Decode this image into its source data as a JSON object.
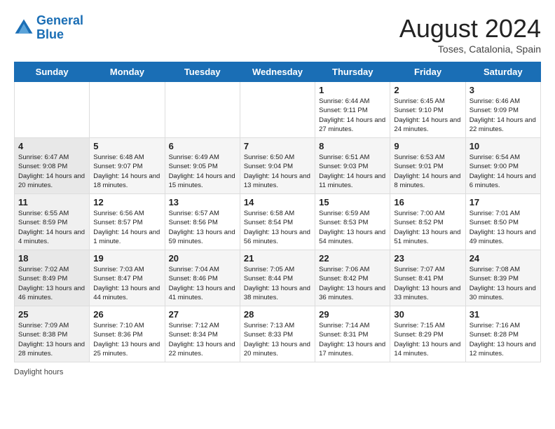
{
  "logo": {
    "line1": "General",
    "line2": "Blue"
  },
  "title": "August 2024",
  "location": "Toses, Catalonia, Spain",
  "days_of_week": [
    "Sunday",
    "Monday",
    "Tuesday",
    "Wednesday",
    "Thursday",
    "Friday",
    "Saturday"
  ],
  "footer_label": "Daylight hours",
  "weeks": [
    [
      {
        "num": "",
        "info": ""
      },
      {
        "num": "",
        "info": ""
      },
      {
        "num": "",
        "info": ""
      },
      {
        "num": "",
        "info": ""
      },
      {
        "num": "1",
        "info": "Sunrise: 6:44 AM\nSunset: 9:11 PM\nDaylight: 14 hours and 27 minutes."
      },
      {
        "num": "2",
        "info": "Sunrise: 6:45 AM\nSunset: 9:10 PM\nDaylight: 14 hours and 24 minutes."
      },
      {
        "num": "3",
        "info": "Sunrise: 6:46 AM\nSunset: 9:09 PM\nDaylight: 14 hours and 22 minutes."
      }
    ],
    [
      {
        "num": "4",
        "info": "Sunrise: 6:47 AM\nSunset: 9:08 PM\nDaylight: 14 hours and 20 minutes."
      },
      {
        "num": "5",
        "info": "Sunrise: 6:48 AM\nSunset: 9:07 PM\nDaylight: 14 hours and 18 minutes."
      },
      {
        "num": "6",
        "info": "Sunrise: 6:49 AM\nSunset: 9:05 PM\nDaylight: 14 hours and 15 minutes."
      },
      {
        "num": "7",
        "info": "Sunrise: 6:50 AM\nSunset: 9:04 PM\nDaylight: 14 hours and 13 minutes."
      },
      {
        "num": "8",
        "info": "Sunrise: 6:51 AM\nSunset: 9:03 PM\nDaylight: 14 hours and 11 minutes."
      },
      {
        "num": "9",
        "info": "Sunrise: 6:53 AM\nSunset: 9:01 PM\nDaylight: 14 hours and 8 minutes."
      },
      {
        "num": "10",
        "info": "Sunrise: 6:54 AM\nSunset: 9:00 PM\nDaylight: 14 hours and 6 minutes."
      }
    ],
    [
      {
        "num": "11",
        "info": "Sunrise: 6:55 AM\nSunset: 8:59 PM\nDaylight: 14 hours and 4 minutes."
      },
      {
        "num": "12",
        "info": "Sunrise: 6:56 AM\nSunset: 8:57 PM\nDaylight: 14 hours and 1 minute."
      },
      {
        "num": "13",
        "info": "Sunrise: 6:57 AM\nSunset: 8:56 PM\nDaylight: 13 hours and 59 minutes."
      },
      {
        "num": "14",
        "info": "Sunrise: 6:58 AM\nSunset: 8:54 PM\nDaylight: 13 hours and 56 minutes."
      },
      {
        "num": "15",
        "info": "Sunrise: 6:59 AM\nSunset: 8:53 PM\nDaylight: 13 hours and 54 minutes."
      },
      {
        "num": "16",
        "info": "Sunrise: 7:00 AM\nSunset: 8:52 PM\nDaylight: 13 hours and 51 minutes."
      },
      {
        "num": "17",
        "info": "Sunrise: 7:01 AM\nSunset: 8:50 PM\nDaylight: 13 hours and 49 minutes."
      }
    ],
    [
      {
        "num": "18",
        "info": "Sunrise: 7:02 AM\nSunset: 8:49 PM\nDaylight: 13 hours and 46 minutes."
      },
      {
        "num": "19",
        "info": "Sunrise: 7:03 AM\nSunset: 8:47 PM\nDaylight: 13 hours and 44 minutes."
      },
      {
        "num": "20",
        "info": "Sunrise: 7:04 AM\nSunset: 8:46 PM\nDaylight: 13 hours and 41 minutes."
      },
      {
        "num": "21",
        "info": "Sunrise: 7:05 AM\nSunset: 8:44 PM\nDaylight: 13 hours and 38 minutes."
      },
      {
        "num": "22",
        "info": "Sunrise: 7:06 AM\nSunset: 8:42 PM\nDaylight: 13 hours and 36 minutes."
      },
      {
        "num": "23",
        "info": "Sunrise: 7:07 AM\nSunset: 8:41 PM\nDaylight: 13 hours and 33 minutes."
      },
      {
        "num": "24",
        "info": "Sunrise: 7:08 AM\nSunset: 8:39 PM\nDaylight: 13 hours and 30 minutes."
      }
    ],
    [
      {
        "num": "25",
        "info": "Sunrise: 7:09 AM\nSunset: 8:38 PM\nDaylight: 13 hours and 28 minutes."
      },
      {
        "num": "26",
        "info": "Sunrise: 7:10 AM\nSunset: 8:36 PM\nDaylight: 13 hours and 25 minutes."
      },
      {
        "num": "27",
        "info": "Sunrise: 7:12 AM\nSunset: 8:34 PM\nDaylight: 13 hours and 22 minutes."
      },
      {
        "num": "28",
        "info": "Sunrise: 7:13 AM\nSunset: 8:33 PM\nDaylight: 13 hours and 20 minutes."
      },
      {
        "num": "29",
        "info": "Sunrise: 7:14 AM\nSunset: 8:31 PM\nDaylight: 13 hours and 17 minutes."
      },
      {
        "num": "30",
        "info": "Sunrise: 7:15 AM\nSunset: 8:29 PM\nDaylight: 13 hours and 14 minutes."
      },
      {
        "num": "31",
        "info": "Sunrise: 7:16 AM\nSunset: 8:28 PM\nDaylight: 13 hours and 12 minutes."
      }
    ]
  ]
}
